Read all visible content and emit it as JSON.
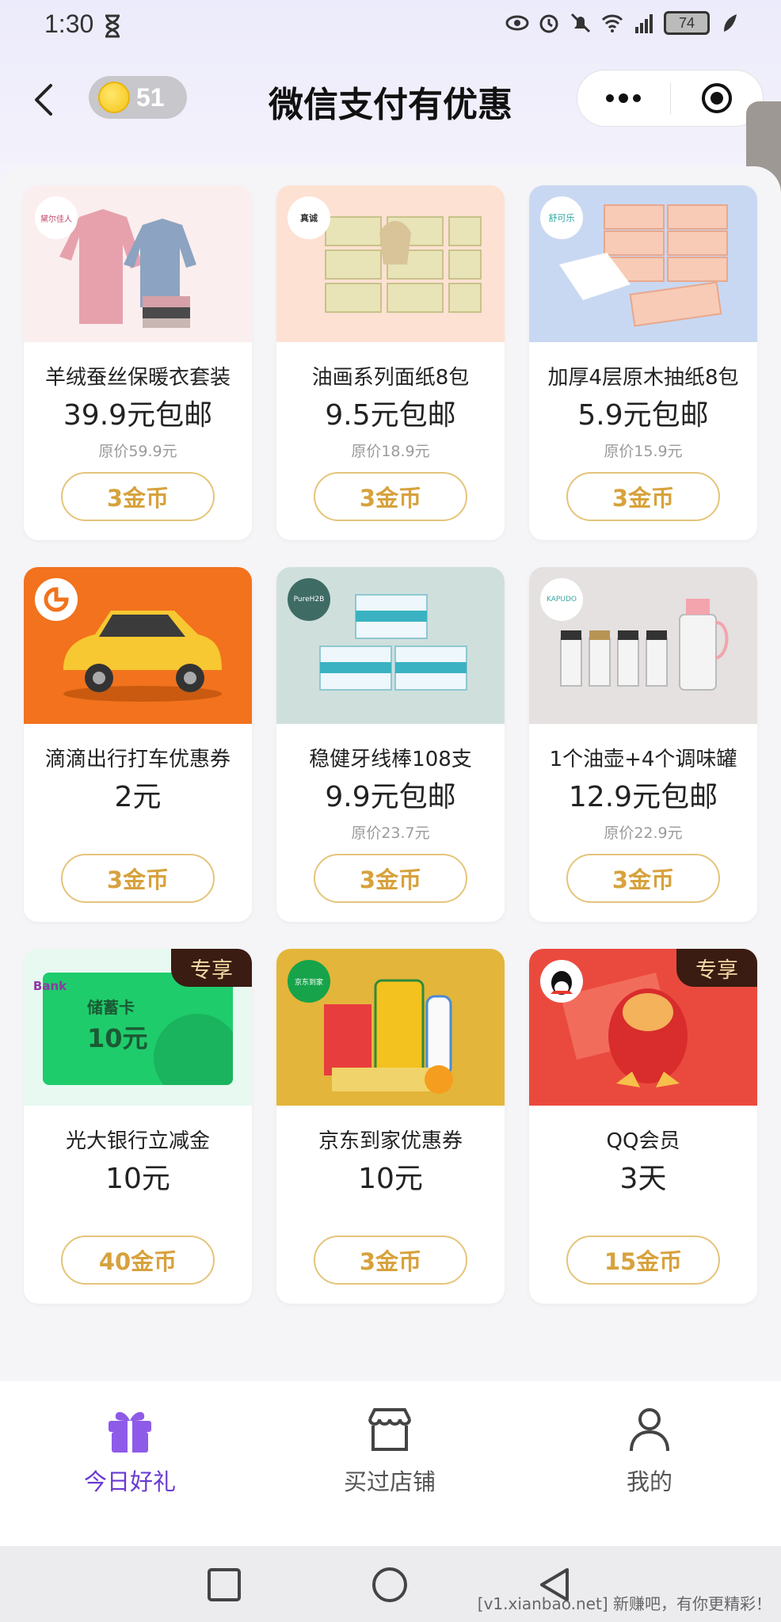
{
  "status_bar": {
    "time": "1:30",
    "network": "4G",
    "battery": "74"
  },
  "header": {
    "coins": "51",
    "title": "微信支付有优惠"
  },
  "products": [
    {
      "name": "羊绒蚕丝保暖衣套装",
      "price": "39.9元包邮",
      "original_price": "原价59.9元",
      "cost": "3金币",
      "logo": "黛尔佳人",
      "bg": "#fbeeee"
    },
    {
      "name": "油画系列面纸8包",
      "price": "9.5元包邮",
      "original_price": "原价18.9元",
      "cost": "3金币",
      "logo": "真诚",
      "bg": "#fde1d3"
    },
    {
      "name": "加厚4层原木抽纸8包",
      "price": "5.9元包邮",
      "original_price": "原价15.9元",
      "cost": "3金币",
      "logo": "舒可乐",
      "bg": "#c9d8f2"
    },
    {
      "name": "滴滴出行打车优惠券",
      "price": "2元",
      "original_price": "",
      "cost": "3金币",
      "logo": "",
      "bg": "#f2721d"
    },
    {
      "name": "稳健牙线棒108支",
      "price": "9.9元包邮",
      "original_price": "原价23.7元",
      "cost": "3金币",
      "logo": "PureH2B",
      "bg": "#cfe0dc"
    },
    {
      "name": "1个油壶+4个调味罐",
      "price": "12.9元包邮",
      "original_price": "原价22.9元",
      "cost": "3金币",
      "logo": "KAPUDO",
      "bg": "#e4e1e0"
    },
    {
      "name": "光大银行立减金",
      "price": "10元",
      "original_price": "",
      "cost": "40金币",
      "logo": "Bank",
      "bg": "#e8f9f1",
      "badge": "专享",
      "card_label": "储蓄卡",
      "card_amount": "10元"
    },
    {
      "name": "京东到家优惠券",
      "price": "10元",
      "original_price": "",
      "cost": "3金币",
      "logo": "京东到家",
      "bg": "#e3b53a"
    },
    {
      "name": "QQ会员",
      "price": "3天",
      "original_price": "",
      "cost": "15金币",
      "logo": "",
      "bg": "#ea4a3e",
      "badge": "专享"
    }
  ],
  "bottom_nav": [
    {
      "label": "今日好礼",
      "active": true
    },
    {
      "label": "买过店铺",
      "active": false
    },
    {
      "label": "我的",
      "active": false
    }
  ],
  "watermark": "[v1.xianbao.net] 新赚吧，有你更精彩！",
  "colors": {
    "accent_purple": "#6a3ad4",
    "gold": "#d7a23d",
    "badge_bg": "#3a1c12"
  }
}
